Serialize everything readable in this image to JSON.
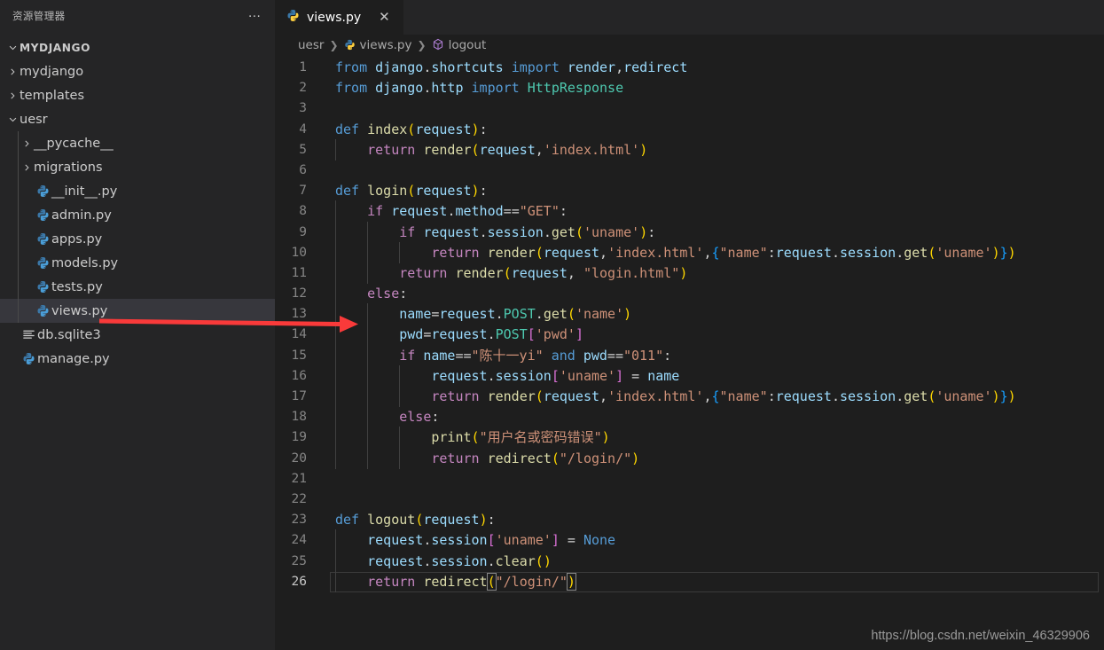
{
  "sidebar": {
    "title": "资源管理器",
    "more_label": "…",
    "root": {
      "label": "MYDJANGO",
      "icon": "chevron-down-icon"
    },
    "items": [
      {
        "label": "mydjango",
        "kind": "folder",
        "icon": "chevron-right-icon",
        "depth": 1,
        "selected": false
      },
      {
        "label": "templates",
        "kind": "folder",
        "icon": "chevron-right-icon",
        "depth": 1,
        "selected": false
      },
      {
        "label": "uesr",
        "kind": "folder",
        "icon": "chevron-down-icon",
        "depth": 1,
        "selected": false
      },
      {
        "label": "__pycache__",
        "kind": "folder",
        "icon": "chevron-right-icon",
        "depth": 2,
        "selected": false
      },
      {
        "label": "migrations",
        "kind": "folder",
        "icon": "chevron-right-icon",
        "depth": 2,
        "selected": false
      },
      {
        "label": "__init__.py",
        "kind": "python",
        "icon": "python-file-icon",
        "depth": 2,
        "selected": false
      },
      {
        "label": "admin.py",
        "kind": "python",
        "icon": "python-file-icon",
        "depth": 2,
        "selected": false
      },
      {
        "label": "apps.py",
        "kind": "python",
        "icon": "python-file-icon",
        "depth": 2,
        "selected": false
      },
      {
        "label": "models.py",
        "kind": "python",
        "icon": "python-file-icon",
        "depth": 2,
        "selected": false
      },
      {
        "label": "tests.py",
        "kind": "python",
        "icon": "python-file-icon",
        "depth": 2,
        "selected": false
      },
      {
        "label": "views.py",
        "kind": "python",
        "icon": "python-file-icon",
        "depth": 2,
        "selected": true
      },
      {
        "label": "db.sqlite3",
        "kind": "db",
        "icon": "database-file-icon",
        "depth": 1,
        "selected": false
      },
      {
        "label": "manage.py",
        "kind": "python",
        "icon": "python-file-icon",
        "depth": 1,
        "selected": false
      }
    ]
  },
  "tabs": [
    {
      "label": "views.py",
      "icon": "python-file-icon",
      "close_label": "✕",
      "active": true
    }
  ],
  "breadcrumb": [
    {
      "label": "uesr",
      "icon": ""
    },
    {
      "label": "views.py",
      "icon": "python-file-icon"
    },
    {
      "label": "logout",
      "icon": "symbol-method-icon"
    }
  ],
  "breadcrumb_separator": "❯",
  "editor": {
    "language": "python",
    "active_line": 26,
    "lines": [
      {
        "n": "1",
        "text": "from django.shortcuts import render,redirect"
      },
      {
        "n": "2",
        "text": "from django.http import HttpResponse"
      },
      {
        "n": "3",
        "text": ""
      },
      {
        "n": "4",
        "text": "def index(request):"
      },
      {
        "n": "5",
        "text": "    return render(request,'index.html')"
      },
      {
        "n": "6",
        "text": ""
      },
      {
        "n": "7",
        "text": "def login(request):"
      },
      {
        "n": "8",
        "text": "    if request.method==\"GET\":"
      },
      {
        "n": "9",
        "text": "        if request.session.get('uname'):"
      },
      {
        "n": "10",
        "text": "            return render(request,'index.html',{\"name\":request.session.get('uname')})"
      },
      {
        "n": "11",
        "text": "        return render(request, \"login.html\")"
      },
      {
        "n": "12",
        "text": "    else:"
      },
      {
        "n": "13",
        "text": "        name=request.POST.get('name')"
      },
      {
        "n": "14",
        "text": "        pwd=request.POST['pwd']"
      },
      {
        "n": "15",
        "text": "        if name==\"陈十一yi\" and pwd==\"011\":"
      },
      {
        "n": "16",
        "text": "            request.session['uname'] = name"
      },
      {
        "n": "17",
        "text": "            return render(request,'index.html',{\"name\":request.session.get('uname')})"
      },
      {
        "n": "18",
        "text": "        else:"
      },
      {
        "n": "19",
        "text": "            print(\"用户名或密码错误\")"
      },
      {
        "n": "20",
        "text": "            return redirect(\"/login/\")"
      },
      {
        "n": "21",
        "text": ""
      },
      {
        "n": "22",
        "text": ""
      },
      {
        "n": "23",
        "text": "def logout(request):"
      },
      {
        "n": "24",
        "text": "    request.session['uname'] = None"
      },
      {
        "n": "25",
        "text": "    request.session.clear()"
      },
      {
        "n": "26",
        "text": "    return redirect(\"/login/\")"
      }
    ]
  },
  "annotation": {
    "type": "red-arrow",
    "color": "#f93a3a",
    "points_from": "views.py",
    "points_to": "line-13"
  },
  "watermark": "https://blog.csdn.net/weixin_46329906",
  "colors": {
    "sidebar_bg": "#252526",
    "editor_bg": "#1e1e1e",
    "selection_bg": "#37373d",
    "accent": "#569cd6",
    "annotation_red": "#f93a3a"
  }
}
